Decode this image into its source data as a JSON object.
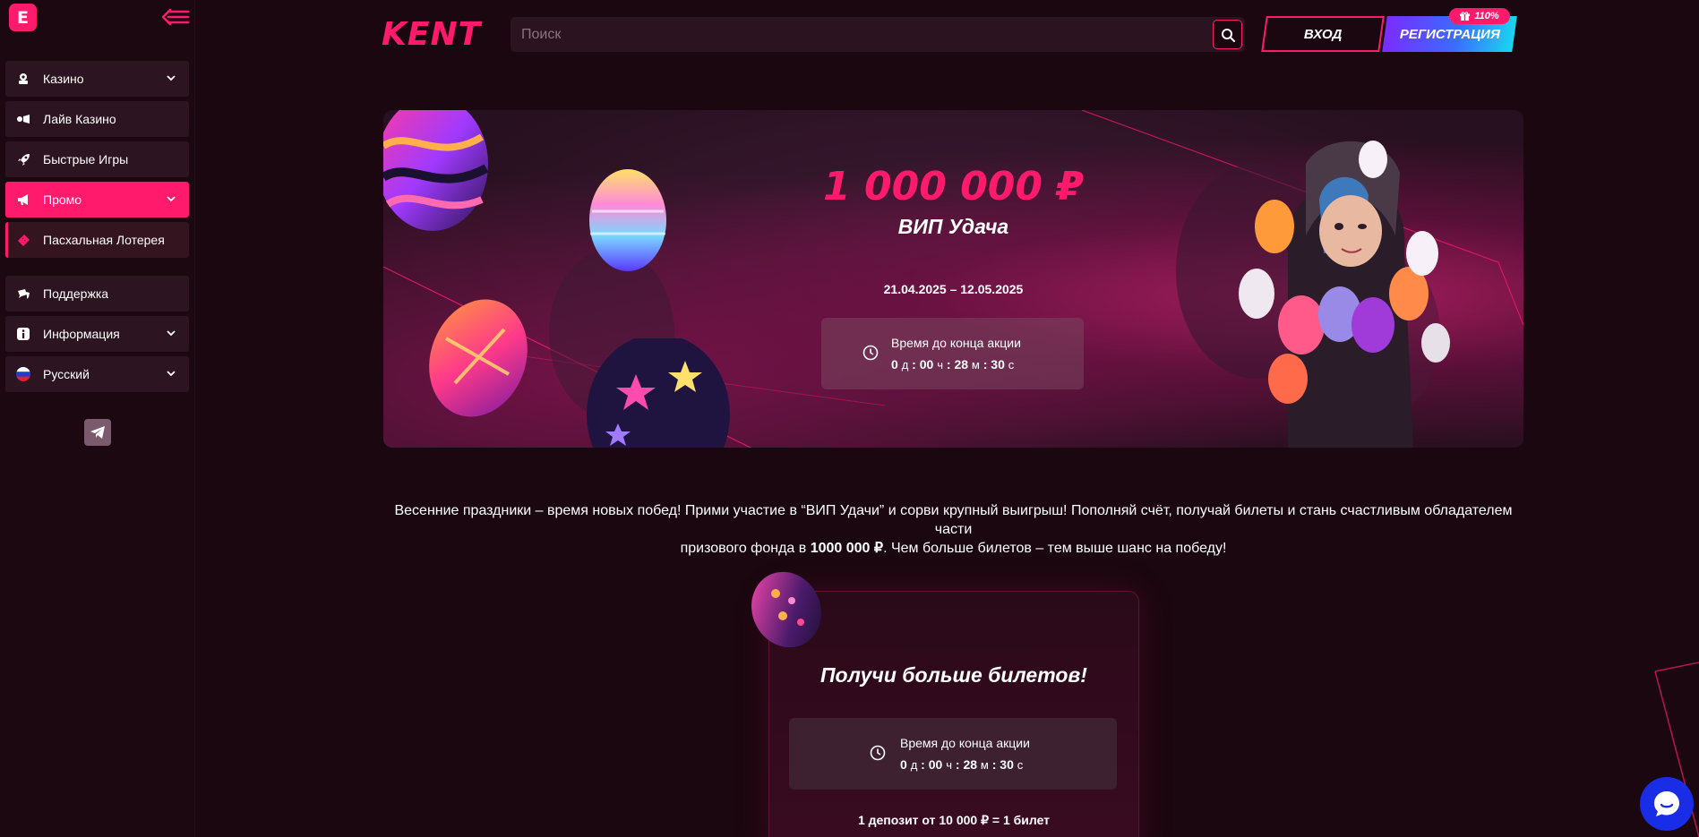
{
  "sidebar": {
    "brand_icon": "E",
    "collapse_icon": "collapse-arrow-icon",
    "items": [
      {
        "label": "Казино",
        "icon": "casino-chip-icon",
        "has_chevron": true
      },
      {
        "label": "Лайв Казино",
        "icon": "live-dealer-icon",
        "has_chevron": false
      },
      {
        "label": "Быстрые Игры",
        "icon": "rocket-icon",
        "has_chevron": false
      },
      {
        "label": "Промо",
        "icon": "megaphone-icon",
        "has_chevron": true,
        "active": true
      },
      {
        "label": "Пасхальная Лотерея",
        "icon": "ticket-icon",
        "has_chevron": false
      },
      {
        "label": "Поддержка",
        "icon": "chat-support-icon",
        "has_chevron": false
      },
      {
        "label": "Информация",
        "icon": "info-icon",
        "has_chevron": true
      },
      {
        "label": "Русский",
        "icon": "russia-flag-icon",
        "has_chevron": true
      }
    ],
    "telegram_icon": "telegram-icon"
  },
  "header": {
    "logo": "KENT",
    "search_placeholder": "Поиск",
    "search_icon": "search-icon",
    "login_label": "ВХОД",
    "register_label": "РЕГИСТРАЦИЯ",
    "bonus_badge": "110%"
  },
  "banner": {
    "prize": "1 000 000 ₽",
    "promo_name": "ВИП Удача",
    "dates": "21.04.2025 – 12.05.2025",
    "timer_label": "Время до конца акции",
    "days": "0",
    "hours": "00",
    "minutes": "28",
    "seconds": "30",
    "unit_days": "д",
    "unit_hours": "ч",
    "unit_minutes": "м",
    "unit_seconds": "с"
  },
  "description": {
    "line1": "Весенние праздники – время новых побед! Прими участие в “ВИП Удачи” и сорви крупный выигрыш! Пополняй счёт, получай билеты и стань счастливым обладателем части",
    "line2_prefix": "призового фонда в ",
    "line2_amount": "1000 000 ₽",
    "line2_suffix": ". Чем больше билетов – тем выше шанс на победу!"
  },
  "tickets_card": {
    "title": "Получи больше билетов!",
    "timer_label": "Время до конца акции",
    "days": "0",
    "hours": "00",
    "minutes": "28",
    "seconds": "30",
    "unit_days": "д",
    "unit_hours": "ч",
    "unit_minutes": "м",
    "unit_seconds": "с",
    "rule": "1 депозит от 10 000 ₽ = 1 билет"
  },
  "chat": {
    "icon": "live-chat-icon"
  },
  "colors": {
    "accent": "#ff1a6c",
    "background": "#1a0710",
    "sidebar_item": "#2c1420",
    "register_gradient_start": "#7a2cff",
    "register_gradient_end": "#19d6f0",
    "chat_button": "#1a2de6"
  }
}
